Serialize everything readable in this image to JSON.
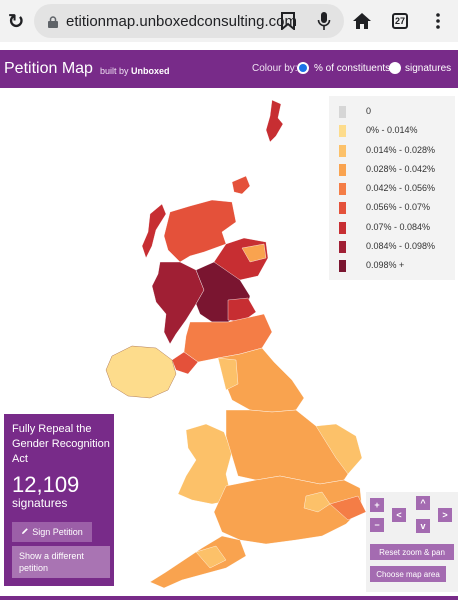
{
  "browser": {
    "url": "etitionmap.unboxedconsulting.com",
    "tab_count": "27"
  },
  "header": {
    "title": "Petition Map",
    "built_by_prefix": "built by ",
    "built_by_name": "Unboxed",
    "colour_by_label": "Colour by:",
    "options": [
      "% of constituents",
      "signatures"
    ],
    "selected_option": "% of constituents"
  },
  "legend": {
    "items": [
      {
        "label": "0",
        "color": "#d6d6d6"
      },
      {
        "label": "0% - 0.014%",
        "color": "#fddc8c"
      },
      {
        "label": "0.014% - 0.028%",
        "color": "#fcc169"
      },
      {
        "label": "0.028% - 0.042%",
        "color": "#f9a34f"
      },
      {
        "label": "0.042% - 0.056%",
        "color": "#f47d46"
      },
      {
        "label": "0.056% - 0.07%",
        "color": "#e4513a"
      },
      {
        "label": "0.07% - 0.084%",
        "color": "#c72e32"
      },
      {
        "label": "0.084% - 0.098%",
        "color": "#a01f34"
      },
      {
        "label": "0.098% +",
        "color": "#7a1530"
      }
    ]
  },
  "petition": {
    "title": "Fully Repeal the Gender Recognition Act",
    "count": "12,109",
    "count_label": "signatures",
    "sign_button": "Sign Petition",
    "different_button": "Show a different petition"
  },
  "controls": {
    "zoom_in": "+",
    "zoom_out": "−",
    "pan_up": "^",
    "pan_down": "v",
    "pan_left": "<",
    "pan_right": ">",
    "reset": "Reset zoom & pan",
    "choose_area": "Choose map area"
  },
  "colors": {
    "brand": "#782b89",
    "button": "#a46bb1"
  }
}
